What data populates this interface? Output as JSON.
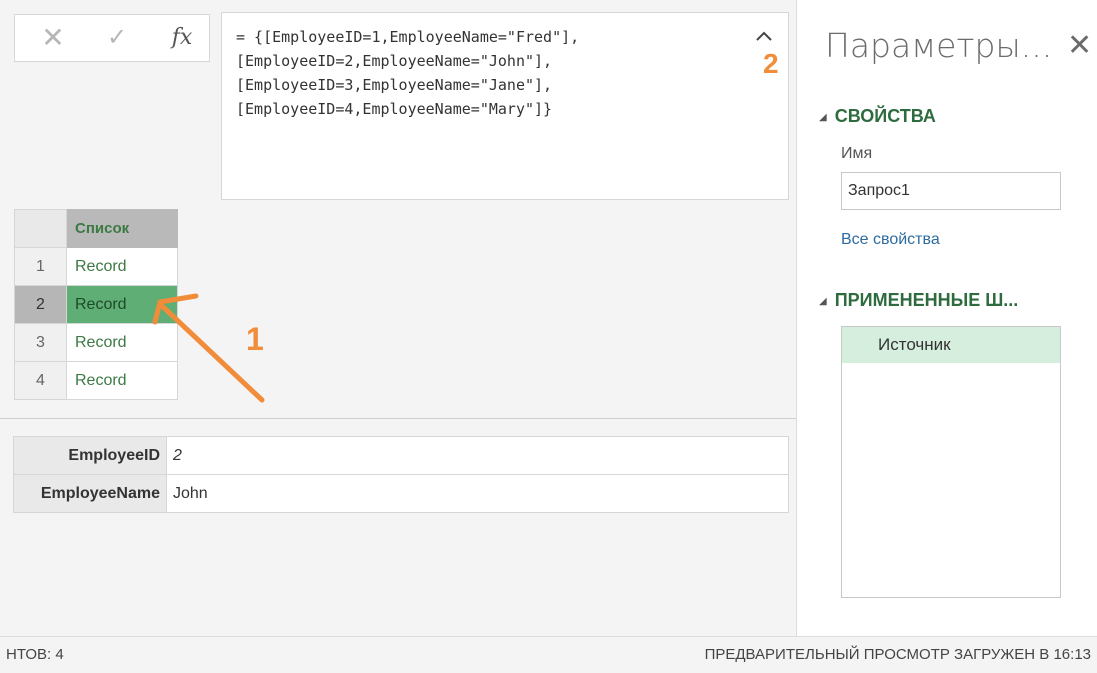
{
  "formula_bar": {
    "cancel_glyph": "✕",
    "confirm_glyph": "✓",
    "fx_label": "fx",
    "formula_lines": [
      "= {[EmployeeID=1,EmployeeName=\"Fred\"],",
      "[EmployeeID=2,EmployeeName=\"John\"],",
      "[EmployeeID=3,EmployeeName=\"Jane\"],",
      "[EmployeeID=4,EmployeeName=\"Mary\"]}"
    ],
    "collapse_icon": "chevron-up-icon"
  },
  "annotations": {
    "label_1": "1",
    "label_2": "2",
    "color": "#f08c3a"
  },
  "grid": {
    "column_header": "Список",
    "rows": [
      {
        "num": "1",
        "value": "Record",
        "selected": false
      },
      {
        "num": "2",
        "value": "Record",
        "selected": true
      },
      {
        "num": "3",
        "value": "Record",
        "selected": false
      },
      {
        "num": "4",
        "value": "Record",
        "selected": false
      }
    ]
  },
  "record_details": {
    "fields": [
      {
        "name": "EmployeeID",
        "value": "2"
      },
      {
        "name": "EmployeeName",
        "value": "John"
      }
    ]
  },
  "settings_pane": {
    "title": "Параметры...",
    "close_glyph": "✕",
    "properties_header": "СВОЙСТВА",
    "name_label": "Имя",
    "name_value": "Запрос1",
    "all_properties_link": "Все свойства",
    "applied_steps_header": "ПРИМЕНЕННЫЕ Ш...",
    "steps": [
      "Источник"
    ]
  },
  "status_bar": {
    "left_text": "НТОВ: 4",
    "right_text": "ПРЕДВАРИТЕЛЬНЫЙ ПРОСМОТР ЗАГРУЖЕН В 16:13"
  },
  "colors": {
    "accent_green": "#2e6b3e",
    "selected_cell": "#5fae75",
    "annotation_orange": "#f08c3a"
  }
}
